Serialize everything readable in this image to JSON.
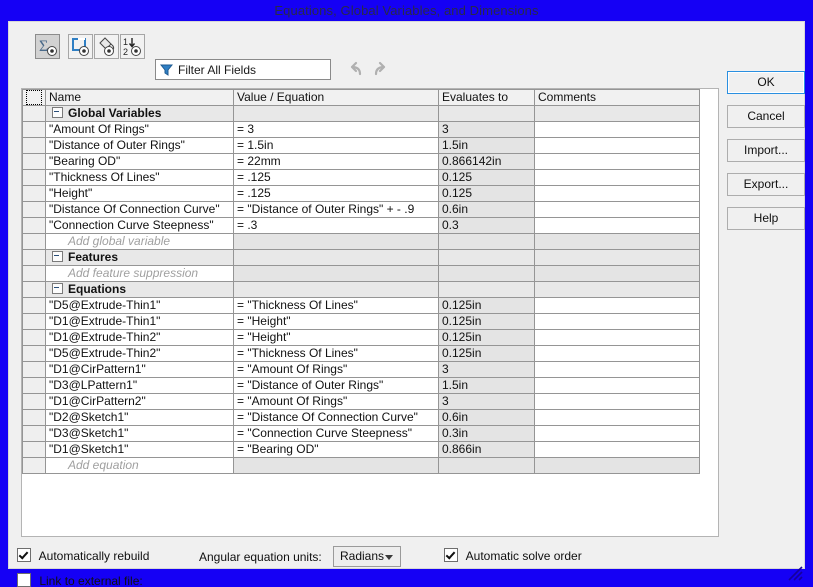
{
  "window": {
    "title": "Equations, Global Variables, and Dimensions",
    "title_bar_color": "#1500f5"
  },
  "toolbar": {
    "buttons": [
      {
        "name": "equation-view-button",
        "icon": "sigma-icon",
        "pressed": true
      },
      {
        "name": "sketch-equation-view-button",
        "icon": "sketch-icon",
        "pressed": false
      },
      {
        "name": "feature-equation-view-button",
        "icon": "paint-icon",
        "pressed": false
      },
      {
        "name": "ordered-view-button",
        "icon": "ordered-list-icon",
        "pressed": false
      }
    ],
    "filter": {
      "placeholder": "Filter All Fields",
      "value": "Filter All Fields",
      "icon": "funnel-icon"
    },
    "undo_label": "Undo",
    "redo_label": "Redo"
  },
  "table": {
    "headers": [
      "Name",
      "Value / Equation",
      "Evaluates to",
      "Comments"
    ],
    "groups": [
      {
        "title": "Global Variables",
        "rows": [
          {
            "name": "\"Amount Of Rings\"",
            "value": "= 3",
            "eval": "3",
            "comment": ""
          },
          {
            "name": "\"Distance of Outer Rings\"",
            "value": "= 1.5in",
            "eval": "1.5in",
            "comment": ""
          },
          {
            "name": "\"Bearing OD\"",
            "value": "= 22mm",
            "eval": "0.866142in",
            "comment": ""
          },
          {
            "name": "\"Thickness Of Lines\"",
            "value": "= .125",
            "eval": "0.125",
            "comment": ""
          },
          {
            "name": "\"Height\"",
            "value": "= .125",
            "eval": "0.125",
            "comment": ""
          },
          {
            "name": "\"Distance Of Connection Curve\"",
            "value": "= \"Distance of Outer Rings\" + - .9",
            "eval": "0.6in",
            "comment": ""
          },
          {
            "name": "\"Connection Curve Steepness\"",
            "value": "= .3",
            "eval": "0.3",
            "comment": ""
          }
        ],
        "add_label": "Add global variable"
      },
      {
        "title": "Features",
        "rows": [],
        "add_label": "Add feature suppression"
      },
      {
        "title": "Equations",
        "rows": [
          {
            "name": "\"D5@Extrude-Thin1\"",
            "value": "= \"Thickness Of Lines\"",
            "eval": "0.125in",
            "comment": ""
          },
          {
            "name": "\"D1@Extrude-Thin1\"",
            "value": "= \"Height\"",
            "eval": "0.125in",
            "comment": ""
          },
          {
            "name": "\"D1@Extrude-Thin2\"",
            "value": "= \"Height\"",
            "eval": "0.125in",
            "comment": ""
          },
          {
            "name": "\"D5@Extrude-Thin2\"",
            "value": "= \"Thickness Of Lines\"",
            "eval": "0.125in",
            "comment": ""
          },
          {
            "name": "\"D1@CirPattern1\"",
            "value": "= \"Amount Of Rings\"",
            "eval": "3",
            "comment": ""
          },
          {
            "name": "\"D3@LPattern1\"",
            "value": "= \"Distance of Outer Rings\"",
            "eval": "1.5in",
            "comment": ""
          },
          {
            "name": "\"D1@CirPattern2\"",
            "value": "= \"Amount Of Rings\"",
            "eval": "3",
            "comment": ""
          },
          {
            "name": "\"D2@Sketch1\"",
            "value": "= \"Distance Of Connection Curve\"",
            "eval": "0.6in",
            "comment": ""
          },
          {
            "name": "\"D3@Sketch1\"",
            "value": "= \"Connection Curve Steepness\"",
            "eval": "0.3in",
            "comment": ""
          },
          {
            "name": "\"D1@Sketch1\"",
            "value": "= \"Bearing OD\"",
            "eval": "0.866in",
            "comment": ""
          }
        ],
        "add_label": "Add equation"
      }
    ]
  },
  "side_buttons": [
    {
      "label": "OK",
      "name": "ok-button",
      "default": true
    },
    {
      "label": "Cancel",
      "name": "cancel-button",
      "default": false
    },
    {
      "label": "Import...",
      "name": "import-button",
      "default": false
    },
    {
      "label": "Export...",
      "name": "export-button",
      "default": false
    },
    {
      "label": "Help",
      "name": "help-button",
      "default": false
    }
  ],
  "footer": {
    "auto_rebuild": {
      "label": "Automatically rebuild",
      "checked": true
    },
    "link_external": {
      "label": "Link to external file:",
      "checked": false
    },
    "angular_units": {
      "label": "Angular equation units:",
      "value": "Radians"
    },
    "auto_solve": {
      "label": "Automatic solve order",
      "checked": true
    }
  }
}
